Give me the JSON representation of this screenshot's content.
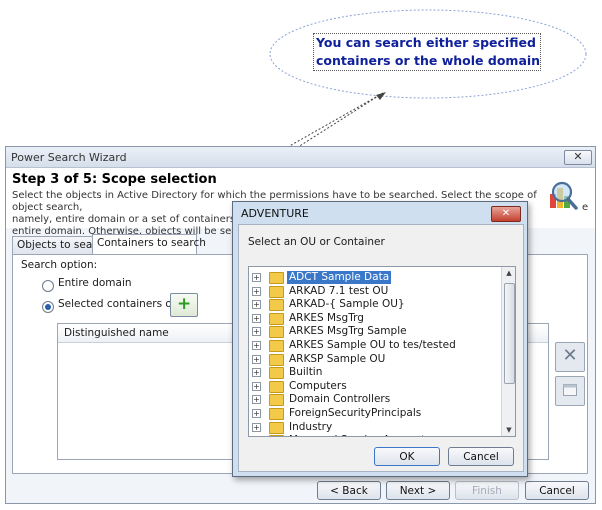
{
  "callout": {
    "line1": "You can search either specified",
    "line2": "containers or the whole domain"
  },
  "wizard": {
    "title": "Power Search Wizard",
    "close_glyph": "✕",
    "step_title": "Step 3 of 5:  Scope selection",
    "step_desc_1": "Select the objects in Active Directory for which the permissions have to be searched. Select the scope of object search,",
    "step_desc_2": "namely, entire domain or a set of containers. When",
    "step_desc_2b": "e",
    "step_desc_3": "entire domain. Otherwise, objects will be searched",
    "tabs": [
      "Objects to search",
      "Containers to search"
    ],
    "search_option_label": "Search option:",
    "radio_entire": "Entire domain",
    "radio_selected": "Selected containers only",
    "add_glyph": "+",
    "grid_header": "Distinguished name",
    "remove_glyph": "✕",
    "buttons": {
      "back": "< Back",
      "next": "Next >",
      "finish": "Finish",
      "cancel": "Cancel"
    }
  },
  "dialog": {
    "title": "ADVENTURE",
    "close_glyph": "✕",
    "prompt": "Select an OU or Container",
    "items": [
      "ADCT Sample Data",
      "ARKAD 7.1 test OU",
      "ARKAD-{ Sample OU}",
      "ARKES MsgTrg",
      "ARKES MsgTrg Sample",
      "ARKES Sample OU to tes/tested",
      "ARKSP Sample OU",
      "Builtin",
      "Computers",
      "Domain Controllers",
      "ForeignSecurityPrincipals",
      "Industry",
      "Managed Service Accounts"
    ],
    "selected_index": 0,
    "ok": "OK",
    "cancel": "Cancel"
  },
  "colors": {
    "callout_text": "#10209a",
    "selection": "#3a77c9",
    "folder": "#f3c94a"
  }
}
